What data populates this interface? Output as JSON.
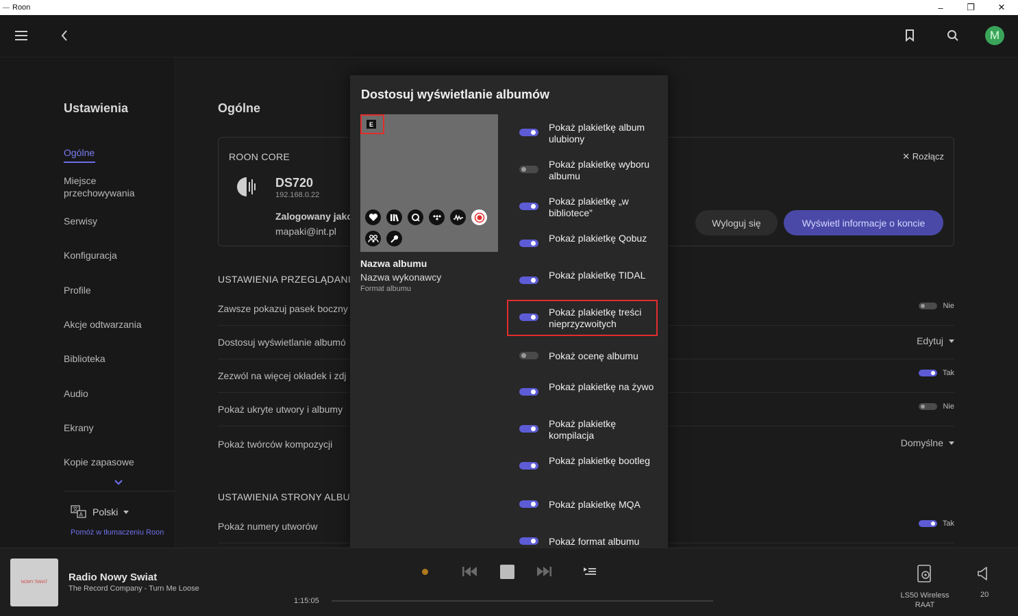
{
  "window": {
    "title": "Roon"
  },
  "sidebar": {
    "title": "Ustawienia",
    "items": [
      {
        "label": "Ogólne",
        "active": true
      },
      {
        "label": "Miejsce przechowywania"
      },
      {
        "label": "Serwisy"
      },
      {
        "label": "Konfiguracja"
      },
      {
        "label": "Profile"
      },
      {
        "label": "Akcje odtwarzania"
      },
      {
        "label": "Biblioteka"
      },
      {
        "label": "Audio"
      },
      {
        "label": "Ekrany"
      },
      {
        "label": "Kopie zapasowe"
      }
    ],
    "language": "Polski",
    "help_link": "Pomóż w tłumaczeniu Roon"
  },
  "main": {
    "title": "Ogólne",
    "core": {
      "section": "ROON CORE",
      "name": "DS720",
      "ip": "192.168.0.22",
      "logged_as": "Zalogowany jako",
      "email": "mapaki@int.pl",
      "disconnect": "Rozłącz",
      "logout_btn": "Wyloguj się",
      "account_btn": "Wyświetl informacje o koncie"
    },
    "browse_section": "USTAWIENIA PRZEGLĄDANI",
    "browse_rows": [
      {
        "label": "Zawsze pokazuj pasek boczny",
        "value": "Nie",
        "kind": "toggle",
        "on": false
      },
      {
        "label": "Dostosuj wyświetlanie albumó",
        "value": "Edytuj",
        "kind": "dropdown"
      },
      {
        "label": "Zezwól na więcej okładek i zdj",
        "value": "Tak",
        "kind": "toggle",
        "on": true
      },
      {
        "label": "Pokaż ukryte utwory i albumy",
        "value": "Nie",
        "kind": "toggle",
        "on": false
      },
      {
        "label": "Pokaż twórców kompozycji",
        "value": "Domyślne",
        "kind": "dropdown"
      }
    ],
    "album_section": "USTAWIENIA STRONY ALBU",
    "album_rows": [
      {
        "label": "Pokaż numery utworów",
        "value": "Tak",
        "kind": "toggle",
        "on": true
      }
    ]
  },
  "modal": {
    "title": "Dostosuj wyświetlanie albumów",
    "explicit_badge": "E",
    "preview": {
      "album": "Nazwa albumu",
      "artist": "Nazwa wykonawcy",
      "format": "Format albumu"
    },
    "options": [
      {
        "label": "Pokaż plakietkę album ulubiony",
        "on": true
      },
      {
        "label": "Pokaż plakietkę wyboru albumu",
        "on": false
      },
      {
        "label": "Pokaż plakietkę „w bibliotece”",
        "on": true
      },
      {
        "label": "Pokaż plakietkę Qobuz",
        "on": true
      },
      {
        "label": "Pokaż plakietkę TIDAL",
        "on": true
      },
      {
        "label": "Pokaż plakietkę treści nieprzyzwoitych",
        "on": true,
        "highlighted": true
      },
      {
        "label": "Pokaż ocenę albumu",
        "on": false
      },
      {
        "label": "Pokaż plakietkę na żywo",
        "on": true
      },
      {
        "label": "Pokaż plakietkę kompilacja",
        "on": true
      },
      {
        "label": "Pokaż plakietkę bootleg",
        "on": true
      },
      {
        "label": "Pokaż plakietkę MQA",
        "on": true
      },
      {
        "label": "Pokaż format albumu",
        "on": true
      }
    ]
  },
  "player": {
    "art_text": "NOWY ŚWIAT",
    "title": "Radio Nowy Swiat",
    "subtitle": "The Record Company - Turn Me Loose",
    "time": "1:15:05",
    "zone_name": "LS50 Wireless",
    "zone_sub": "RAAT",
    "volume": "20"
  },
  "colors": {
    "accent": "#5d5cd6",
    "highlight": "#e32d2d",
    "avatar": "#3aa55a",
    "avatar_letter": "M"
  }
}
